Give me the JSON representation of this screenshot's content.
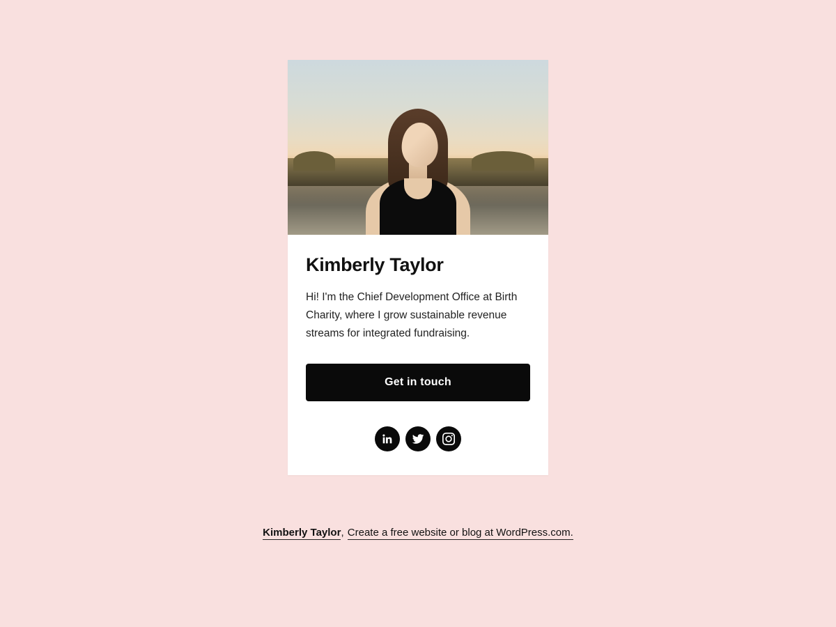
{
  "card": {
    "name": "Kimberly Taylor",
    "bio": "Hi! I'm the Chief Development Office at Birth Charity, where I grow sustainable revenue streams for integrated fundraising.",
    "cta_label": "Get in touch",
    "socials": [
      {
        "name": "linkedin"
      },
      {
        "name": "twitter"
      },
      {
        "name": "instagram"
      }
    ]
  },
  "footer": {
    "site_name": "Kimberly Taylor",
    "separator": ",",
    "tagline": "Create a free website or blog at WordPress.com."
  }
}
